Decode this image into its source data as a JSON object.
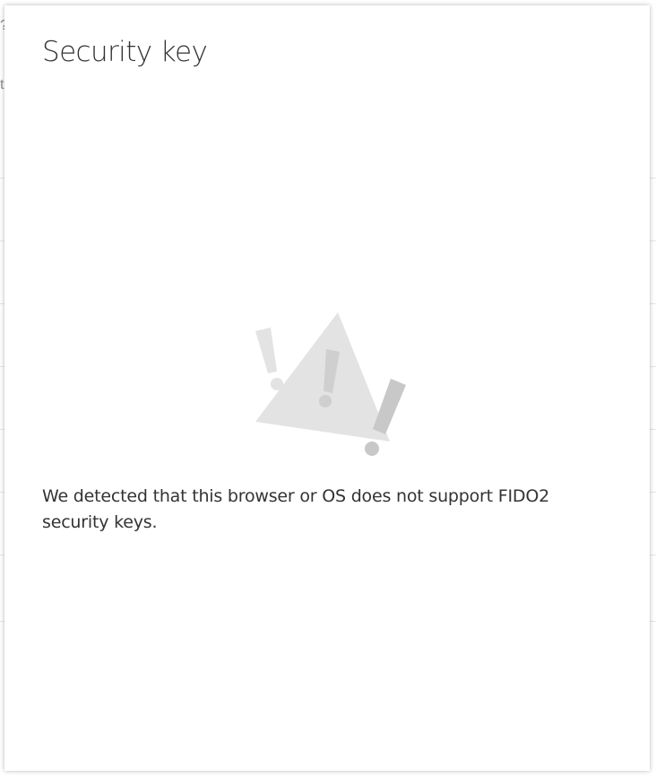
{
  "dialog": {
    "title": "Security key",
    "message": "We detected that this browser or OS does not support FIDO2 security keys.",
    "illustration_icon": "warning-triangle-icon"
  },
  "background": {
    "glyph_1": "?",
    "glyph_2": "t"
  },
  "colors": {
    "title_text": "#333333",
    "body_text": "#333333",
    "illustration_light": "#e3e3e3",
    "illustration_mid": "#c8c8c8"
  }
}
